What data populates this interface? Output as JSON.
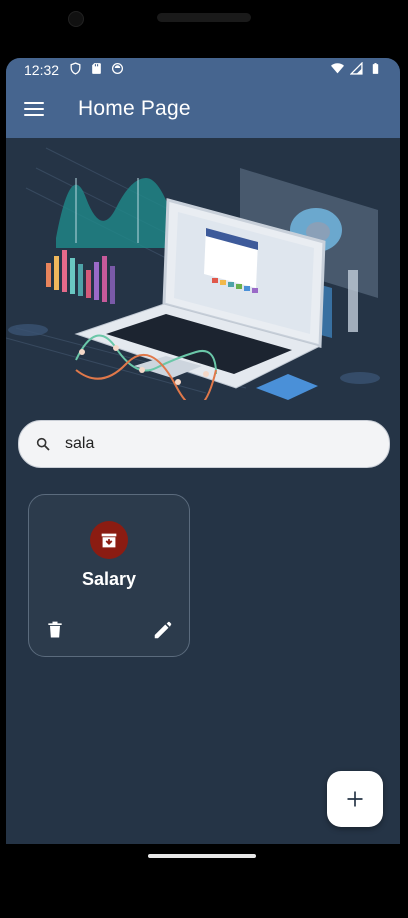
{
  "status_bar": {
    "time": "12:32",
    "left_icons": [
      "shield-icon",
      "sd-card-icon",
      "android-icon"
    ],
    "right_icons": [
      "wifi-icon",
      "signal-icon",
      "battery-icon"
    ]
  },
  "app_bar": {
    "title": "Home Page",
    "menu_icon": "hamburger-menu-icon",
    "color": "#46658f"
  },
  "hero": {
    "illustration": "laptop-analytics-illustration"
  },
  "search": {
    "value": "sala",
    "icon": "search-icon"
  },
  "cards": [
    {
      "title": "Salary",
      "icon": "archive-icon",
      "icon_bg": "#8b1c12",
      "actions": [
        "delete-icon",
        "edit-icon"
      ]
    }
  ],
  "fab": {
    "icon": "add-icon"
  },
  "colors": {
    "background": "#253446",
    "accent": "#46658f",
    "card_border": "#5b6b7d"
  }
}
